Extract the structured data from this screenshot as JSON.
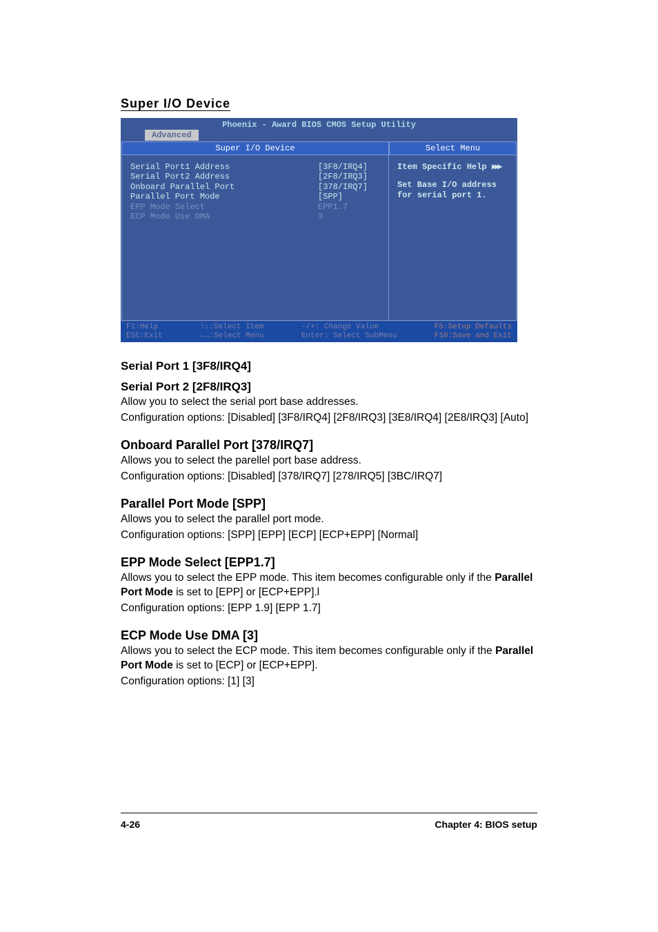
{
  "page": {
    "section_title": "Super I/O Device"
  },
  "bios": {
    "title": "Phoenix - Award BIOS CMOS Setup Utility",
    "tab": "Advanced",
    "header_left": "Super I/O Device",
    "header_right": "Select Menu",
    "items": [
      {
        "label": "Serial Port1 Address",
        "value": "[3F8/IRQ4]",
        "dim": false
      },
      {
        "label": "Serial Port2 Address",
        "value": "[2F8/IRQ3]",
        "dim": false
      },
      {
        "label": "Onboard Parallel Port",
        "value": "[378/IRQ7]",
        "dim": false
      },
      {
        "label": "Parallel Port Mode",
        "value": "[SPP]",
        "dim": false
      },
      {
        "label": "EPP Mode Select",
        "value": " EPP1.7",
        "dim": true
      },
      {
        "label": "ECP Mode Use DMA",
        "value": " 3",
        "dim": true
      }
    ],
    "help": {
      "line1": "Item Specific Help ",
      "arrows": "▶▶▶",
      "line2": "Set Base I/O address",
      "line3": "for serial port 1."
    },
    "footer": {
      "c1": "F1:Help\nESC:Exit",
      "c2": "↑↓:Select Item\n←→:Select Menu",
      "c3": "-/+: Change Value\nEnter: Select SubMenu",
      "c4": "F5:Setup Defaults\nF10:Save and Exit"
    }
  },
  "sections": {
    "serial": {
      "h1": "Serial Port 1 [3F8/IRQ4]",
      "h2": "Serial Port 2 [2F8/IRQ3]",
      "p1": "Allow you to select the serial port base addresses.",
      "p2": "Configuration options: [Disabled] [3F8/IRQ4] [2F8/IRQ3] [3E8/IRQ4] [2E8/IRQ3] [Auto]"
    },
    "parallel": {
      "h": "Onboard Parallel Port [378/IRQ7]",
      "p1": "Allows you to select the parellel port base address.",
      "p2": "Configuration options: [Disabled] [378/IRQ7] [278/IRQ5] [3BC/IRQ7]"
    },
    "ppmode": {
      "h": "Parallel Port Mode [SPP]",
      "p1": "Allows you to select the parallel port mode.",
      "p2": "Configuration options: [SPP] [EPP] [ECP] [ECP+EPP] [Normal]"
    },
    "epp": {
      "h": "EPP Mode Select [EPP1.7]",
      "p1a": "Allows you to select the EPP mode. This item becomes configurable only if the ",
      "p1b": "Parallel Port Mode",
      "p1c": " is set to [EPP] or [ECP+EPP].l",
      "p2": "Configuration options: [EPP 1.9] [EPP 1.7]"
    },
    "ecp": {
      "h": "ECP Mode Use DMA [3]",
      "p1a": "Allows you to select the ECP mode. This item becomes configurable only if the ",
      "p1b": "Parallel Port Mode",
      "p1c": " is set to [ECP] or [ECP+EPP].",
      "p2": "Configuration options: [1] [3]"
    }
  },
  "footer": {
    "left": "4-26",
    "right": "Chapter 4: BIOS setup"
  }
}
